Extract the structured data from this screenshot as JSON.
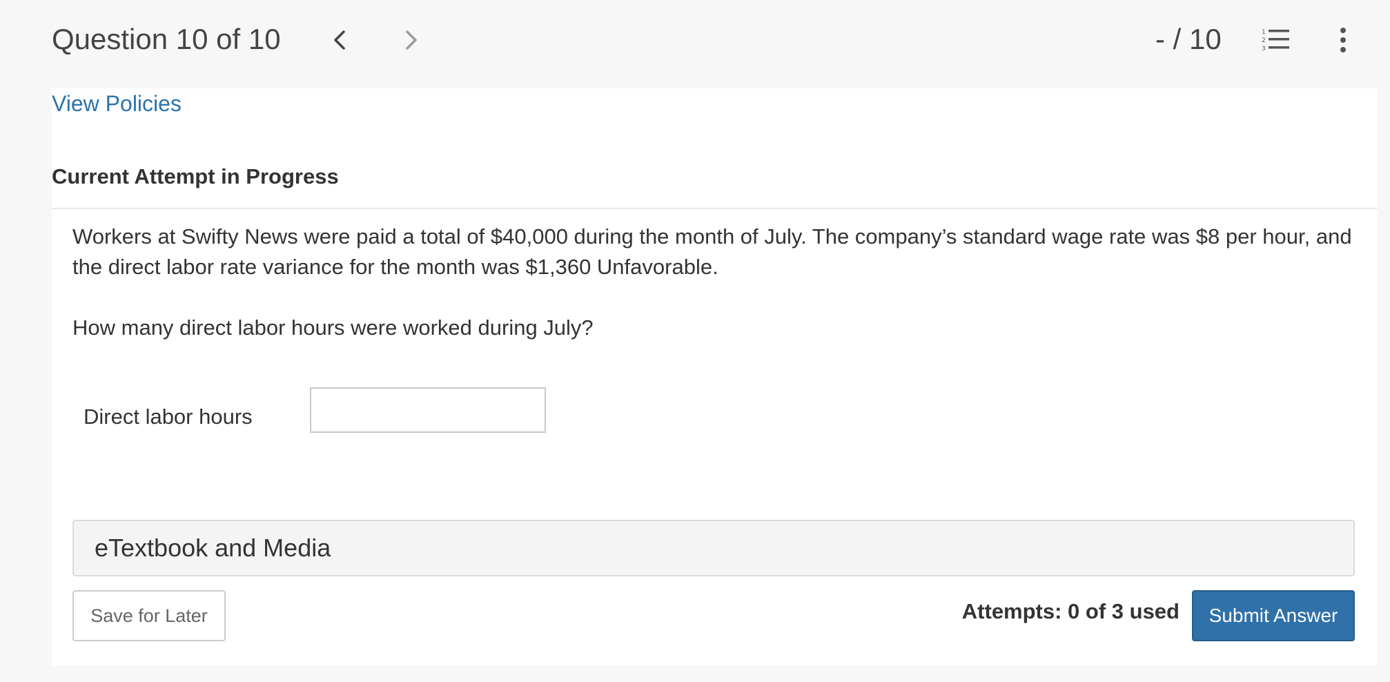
{
  "header": {
    "question_counter": "Question 10 of 10",
    "prev_icon": "chevron-left-icon",
    "next_icon": "chevron-right-icon",
    "score": "- / 10",
    "list_icon": "numbered-list-icon",
    "more_icon": "vertical-ellipsis-icon"
  },
  "links": {
    "view_policies": "View Policies"
  },
  "attempt": {
    "heading": "Current Attempt in Progress"
  },
  "question": {
    "text": "Workers at Swifty News were paid a total of $40,000 during the month of July. The company’s standard wage rate was $8 per hour, and the direct labor rate variance for the month was $1,360 Unfavorable.",
    "prompt": "How many direct labor hours were worked during July?"
  },
  "answer": {
    "label": "Direct labor hours",
    "value": "",
    "placeholder": ""
  },
  "resources": {
    "etextbook_label": "eTextbook and Media"
  },
  "footer": {
    "save_label": "Save for Later",
    "attempts_text": "Attempts: 0 of 3 used",
    "submit_label": "Submit Answer"
  },
  "colors": {
    "link": "#2b73ad",
    "primary_button": "#2f71a8",
    "page_background": "#f7f7f7",
    "panel_background": "#ffffff"
  }
}
